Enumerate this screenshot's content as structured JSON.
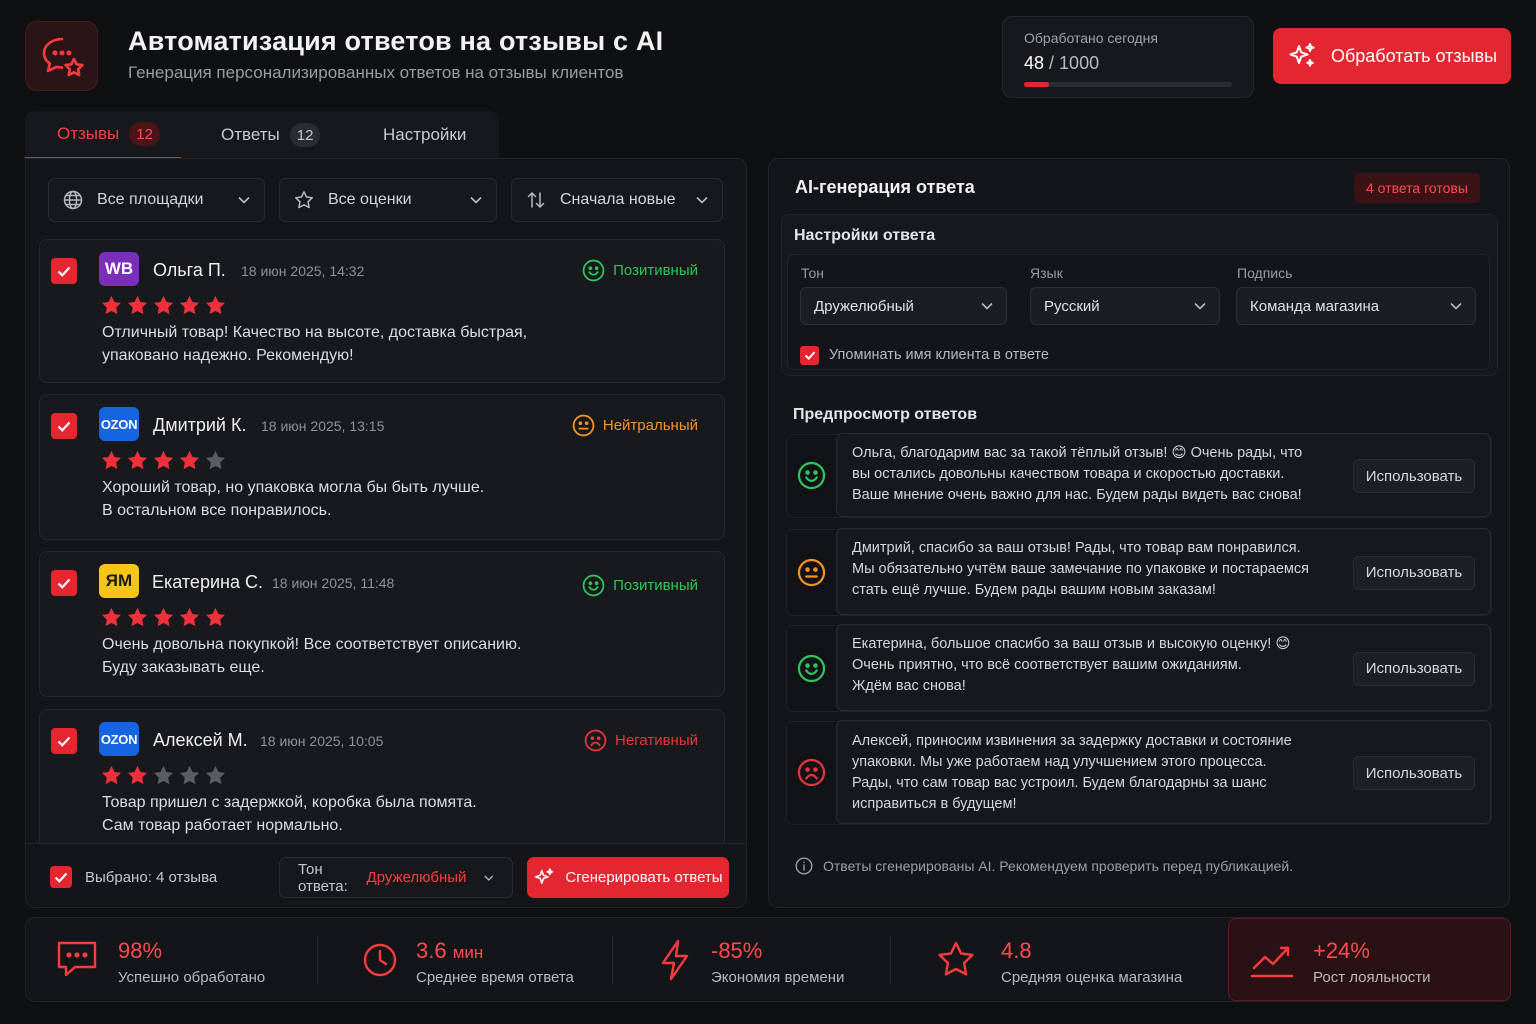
{
  "header": {
    "title": "Автоматизация ответов на отзывы с AI",
    "subtitle": "Генерация персонализированных ответов на отзывы клиентов",
    "counter_label": "Обработано сегодня",
    "counter_value": "48",
    "counter_total": "/ 1000",
    "counter_progress": 0.048,
    "process_button": "Обработать отзывы"
  },
  "tabs": [
    {
      "label": "Отзывы",
      "count": "12",
      "active": true
    },
    {
      "label": "Ответы",
      "count": "12",
      "active": false
    },
    {
      "label": "Настройки",
      "active": false
    }
  ],
  "filters": {
    "platform": "Все площадки",
    "rating": "Все оценки",
    "sort": "Сначала новые"
  },
  "reviews": [
    {
      "platform": "WB",
      "platform_color": "#7b2fb8",
      "name": "Ольга П.",
      "date": "18 июн 2025, 14:32",
      "stars": 5,
      "sentiment": "Позитивный",
      "sentiment_color": "#2ec45a",
      "line1": "Отличный товар! Качество на высоте, доставка быстрая,",
      "line2": "упаковано надежно. Рекомендую!"
    },
    {
      "platform": "OZON",
      "platform_color": "#1565e0",
      "name": "Дмитрий К.",
      "date": "18 июн 2025, 13:15",
      "stars": 4,
      "sentiment": "Нейтральный",
      "sentiment_color": "#f39325",
      "line1": "Хороший товар, но упаковка могла бы быть лучше.",
      "line2": "В остальном все понравилось."
    },
    {
      "platform": "ЯМ",
      "platform_color": "#f5c518",
      "name": "Екатерина С.",
      "date": "18 июн 2025, 11:48",
      "stars": 5,
      "sentiment": "Позитивный",
      "sentiment_color": "#2ec45a",
      "line1": "Очень довольна покупкой! Все соответствует описанию.",
      "line2": "Буду заказывать еще."
    },
    {
      "platform": "OZON",
      "platform_color": "#1565e0",
      "name": "Алексей М.",
      "date": "18 июн 2025, 10:05",
      "stars": 2,
      "sentiment": "Негативный",
      "sentiment_color": "#e8353b",
      "line1": "Товар пришел с задержкой, коробка была помята.",
      "line2": "Сам товар работает нормально."
    }
  ],
  "bottom_bar": {
    "selected": "Выбрано: 4 отзыва",
    "tone_label": "Тон ответа:",
    "tone_value": "Дружелюбный",
    "generate_button": "Сгенерировать ответы"
  },
  "ai_panel": {
    "title": "AI-генерация ответа",
    "ready_badge": "4 ответа готовы",
    "settings_title": "Настройки ответа",
    "tone_label": "Тон",
    "tone_value": "Дружелюбный",
    "language_label": "Язык",
    "language_value": "Русский",
    "signature_label": "Подпись",
    "signature_value": "Команда магазина",
    "mention_name": "Упоминать имя клиента в ответе",
    "preview_title": "Предпросмотр ответов",
    "use_button": "Использовать",
    "note": "Ответы сгенерированы AI. Рекомендуем проверить перед публикацией."
  },
  "previews": [
    {
      "sentiment_color": "#2ec45a",
      "face": "happy",
      "lines": [
        "Ольга, благодарим вас за такой тёплый отзыв! 😊 Очень рады, что",
        "вы остались довольны качеством товара и скоростью доставки.",
        "Ваше мнение очень важно для нас. Будем рады видеть вас снова!"
      ]
    },
    {
      "sentiment_color": "#f39325",
      "face": "neutral",
      "lines": [
        "Дмитрий, спасибо за ваш отзыв! Рады, что товар вам понравился.",
        "Мы обязательно учтём ваше замечание по упаковке и постараемся",
        "стать ещё лучше. Будем рады вашим новым заказам!"
      ]
    },
    {
      "sentiment_color": "#2ec45a",
      "face": "happy",
      "lines": [
        "Екатерина, большое спасибо за ваш отзыв и высокую оценку! 😊",
        "Очень приятно, что всё соответствует вашим ожиданиям.",
        "Ждём вас снова!"
      ]
    },
    {
      "sentiment_color": "#e8353b",
      "face": "sad",
      "lines": [
        "Алексей, приносим извинения за задержку доставки и состояние",
        "упаковки. Мы уже работаем над улучшением этого процесса.",
        "Рады, что сам товар вас устроил. Будем благодарны за шанс",
        "исправиться в будущем!"
      ]
    }
  ],
  "stats": [
    {
      "value": "98%",
      "unit": "",
      "label": "Успешно обработано",
      "icon": "chat-icon"
    },
    {
      "value": "3.6",
      "unit": "мин",
      "label": "Среднее время ответа",
      "icon": "clock-icon"
    },
    {
      "value": "-85%",
      "unit": "",
      "label": "Экономия времени",
      "icon": "lightning-icon"
    },
    {
      "value": "4.8",
      "unit": "",
      "label": "Средняя оценка магазина",
      "icon": "star-icon"
    },
    {
      "value": "+24%",
      "unit": "",
      "label": "Рост лояльности",
      "icon": "trend-icon"
    }
  ],
  "colors": {
    "accent": "#e3262f",
    "positive": "#2ec45a",
    "neutral": "#f39325",
    "negative": "#e8353b"
  }
}
